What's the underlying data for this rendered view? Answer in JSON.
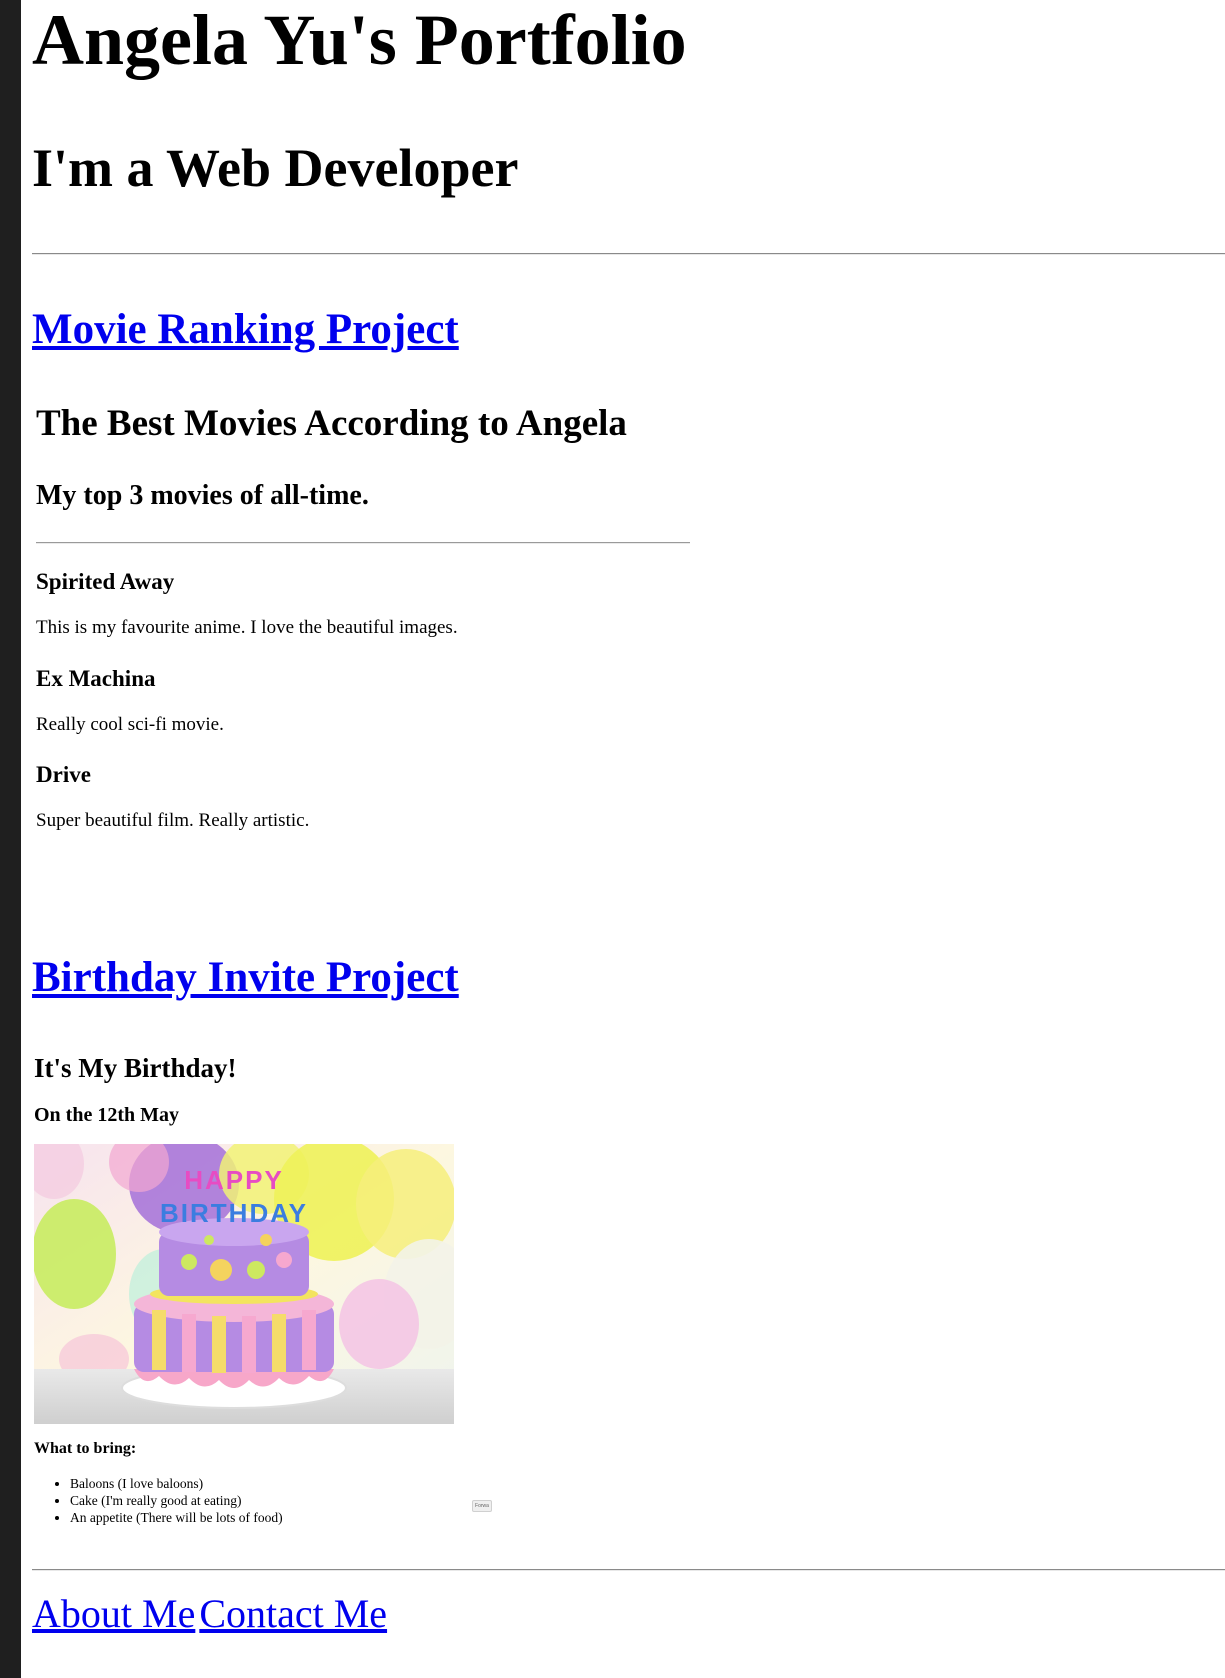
{
  "header": {
    "title": "Angela Yu's Portfolio",
    "subtitle": "I'm a Web Developer"
  },
  "projects": {
    "movie": {
      "link_label": "Movie Ranking Project",
      "page_title": "The Best Movies According to Angela",
      "page_subtitle": "My top 3 movies of all-time.",
      "movies": [
        {
          "title": "Spirited Away",
          "description": "This is my favourite anime. I love the beautiful images."
        },
        {
          "title": "Ex Machina",
          "description": "Really cool sci-fi movie."
        },
        {
          "title": "Drive",
          "description": "Super beautiful film. Really artistic."
        }
      ]
    },
    "birthday": {
      "link_label": "Birthday Invite Project",
      "page_title": "It's My Birthday!",
      "page_subtitle": "On the 12th May",
      "cake_lettering": "HAPPY BIRTHDAY",
      "bring_heading": "What to bring:",
      "bring_items": [
        "Baloons (I love baloons)",
        "Cake (I'm really good at eating)",
        "An appetite (There will be lots of food)"
      ],
      "forward_button_label": "Forwa"
    }
  },
  "footer": {
    "about_label": "About Me",
    "contact_label": "Contact Me"
  },
  "colors": {
    "link": "#0000ee",
    "left_bar": "#1f1f1f"
  }
}
